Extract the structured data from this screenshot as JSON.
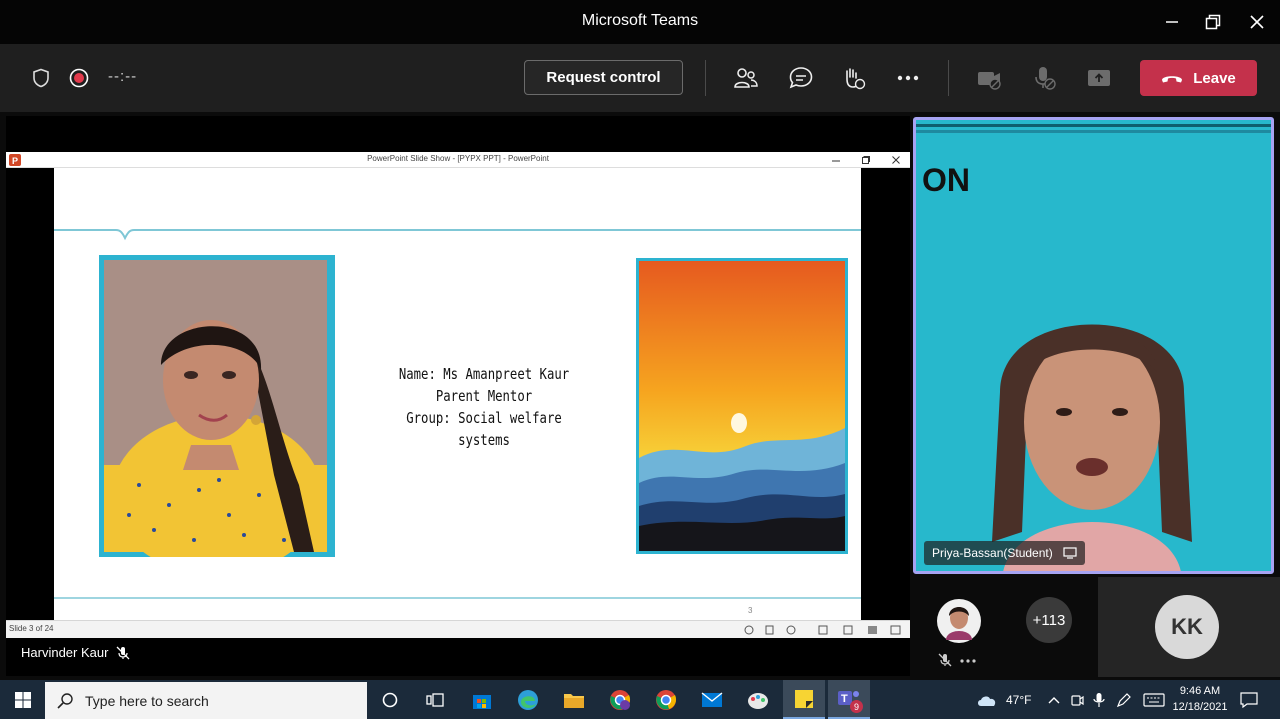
{
  "window": {
    "title": "Microsoft Teams"
  },
  "toolbar": {
    "timer": "--:--",
    "request_control_label": "Request control",
    "leave_label": "Leave"
  },
  "presentation": {
    "window_title": "PowerPoint Slide Show - [PYPX PPT] - PowerPoint",
    "status_slide": "Slide 3 of 24",
    "slide": {
      "line1": "Name: Ms Amanpreet Kaur",
      "line2": "Parent Mentor",
      "line3": "Group: Social welfare systems",
      "page_number": "3"
    },
    "presenter": "Harvinder Kaur"
  },
  "video": {
    "participant_name": "Priya-Bassan(Student)",
    "background_text": "ON"
  },
  "participants": {
    "more_count": "+113",
    "kk_initials": "KK"
  },
  "taskbar": {
    "search_placeholder": "Type here to search",
    "weather": "47°F",
    "time": "9:46 AM",
    "date": "12/18/2021",
    "teams_badge": "9"
  }
}
